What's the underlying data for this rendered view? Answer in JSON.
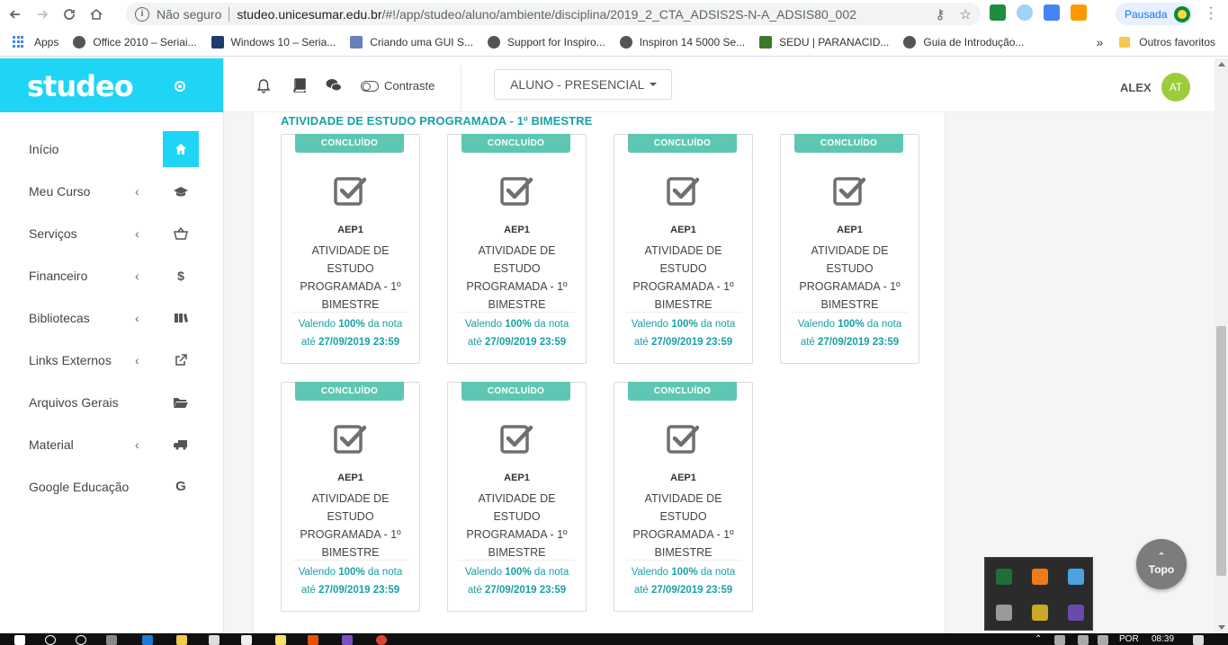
{
  "browser": {
    "security_label": "Não seguro",
    "url_host": "studeo.unicesumar.edu.br",
    "url_path": "/#!/app/studeo/aluno/ambiente/disciplina/2019_2_CTA_ADSIS2S-N-A_ADSIS80_002",
    "profile_label": "Pausada",
    "bookmarks": [
      "Apps",
      "Office 2010 – Seriai...",
      "Windows 10 – Seria...",
      "Criando uma GUI S...",
      "Support for Inspiro...",
      "Inspiron 14 5000 Se...",
      "SEDU | PARANACID...",
      "Guia de Introdução..."
    ],
    "more_bookmarks": "»",
    "other_bookmarks": "Outros favoritos"
  },
  "brand": {
    "logo": "studeo",
    "color": "#1fd5f5"
  },
  "sidebar": {
    "items": [
      {
        "label": "Início",
        "icon": "home-icon",
        "has_chevron": false,
        "active": true
      },
      {
        "label": "Meu Curso",
        "icon": "graduation-cap-icon",
        "has_chevron": true
      },
      {
        "label": "Serviços",
        "icon": "basket-icon",
        "has_chevron": true
      },
      {
        "label": "Financeiro",
        "icon": "dollar-icon",
        "has_chevron": true
      },
      {
        "label": "Bibliotecas",
        "icon": "library-icon",
        "has_chevron": true
      },
      {
        "label": "Links Externos",
        "icon": "external-link-icon",
        "has_chevron": true
      },
      {
        "label": "Arquivos Gerais",
        "icon": "folder-open-icon",
        "has_chevron": false
      },
      {
        "label": "Material",
        "icon": "truck-icon",
        "has_chevron": true
      },
      {
        "label": "Google Educação",
        "icon": "google-icon",
        "has_chevron": false
      }
    ]
  },
  "header": {
    "contrast_label": "Contraste",
    "role_select": "ALUNO - PRESENCIAL",
    "user_name": "ALEX",
    "avatar_initials": "AT"
  },
  "main": {
    "section_title": "ATIVIDADE DE ESTUDO PROGRAMADA - 1º BIMESTRE",
    "cards": [
      {
        "badge": "CONCLUÍDO",
        "code": "AEP1",
        "name_lines": [
          "ATIVIDADE DE",
          "ESTUDO",
          "PROGRAMADA - 1º",
          "BIMESTRE"
        ],
        "weight_pre": "Valendo ",
        "weight_pct": "100%",
        "weight_post": " da nota",
        "due_pre": "até ",
        "due": "27/09/2019 23:59"
      },
      {
        "badge": "CONCLUÍDO",
        "code": "AEP1",
        "name_lines": [
          "ATIVIDADE DE",
          "ESTUDO",
          "PROGRAMADA - 1º",
          "BIMESTRE"
        ],
        "weight_pre": "Valendo ",
        "weight_pct": "100%",
        "weight_post": " da nota",
        "due_pre": "até ",
        "due": "27/09/2019 23:59"
      },
      {
        "badge": "CONCLUÍDO",
        "code": "AEP1",
        "name_lines": [
          "ATIVIDADE DE",
          "ESTUDO",
          "PROGRAMADA - 1º",
          "BIMESTRE"
        ],
        "weight_pre": "Valendo ",
        "weight_pct": "100%",
        "weight_post": " da nota",
        "due_pre": "até ",
        "due": "27/09/2019 23:59"
      },
      {
        "badge": "CONCLUÍDO",
        "code": "AEP1",
        "name_lines": [
          "ATIVIDADE DE",
          "ESTUDO",
          "PROGRAMADA - 1º",
          "BIMESTRE"
        ],
        "weight_pre": "Valendo ",
        "weight_pct": "100%",
        "weight_post": " da nota",
        "due_pre": "até ",
        "due": "27/09/2019 23:59"
      },
      {
        "badge": "CONCLUÍDO",
        "code": "AEP1",
        "name_lines": [
          "ATIVIDADE DE",
          "ESTUDO",
          "PROGRAMADA - 1º",
          "BIMESTRE"
        ],
        "weight_pre": "Valendo ",
        "weight_pct": "100%",
        "weight_post": " da nota",
        "due_pre": "até ",
        "due": "27/09/2019 23:59"
      },
      {
        "badge": "CONCLUÍDO",
        "code": "AEP1",
        "name_lines": [
          "ATIVIDADE DE",
          "ESTUDO",
          "PROGRAMADA - 1º",
          "BIMESTRE"
        ],
        "weight_pre": "Valendo ",
        "weight_pct": "100%",
        "weight_post": " da nota",
        "due_pre": "até ",
        "due": "27/09/2019 23:59"
      },
      {
        "badge": "CONCLUÍDO",
        "code": "AEP1",
        "name_lines": [
          "ATIVIDADE DE",
          "ESTUDO",
          "PROGRAMADA - 1º",
          "BIMESTRE"
        ],
        "weight_pre": "Valendo ",
        "weight_pct": "100%",
        "weight_post": " da nota",
        "due_pre": "até ",
        "due": "27/09/2019 23:59"
      }
    ]
  },
  "topo_label": "Topo",
  "taskbar": {
    "lang": "POR",
    "time": "08:39"
  },
  "colors": {
    "accent": "#1fd5f5",
    "teal_text": "#1aa0a6",
    "badge": "#5ec7b3",
    "avatar": "#9ccc3a"
  }
}
